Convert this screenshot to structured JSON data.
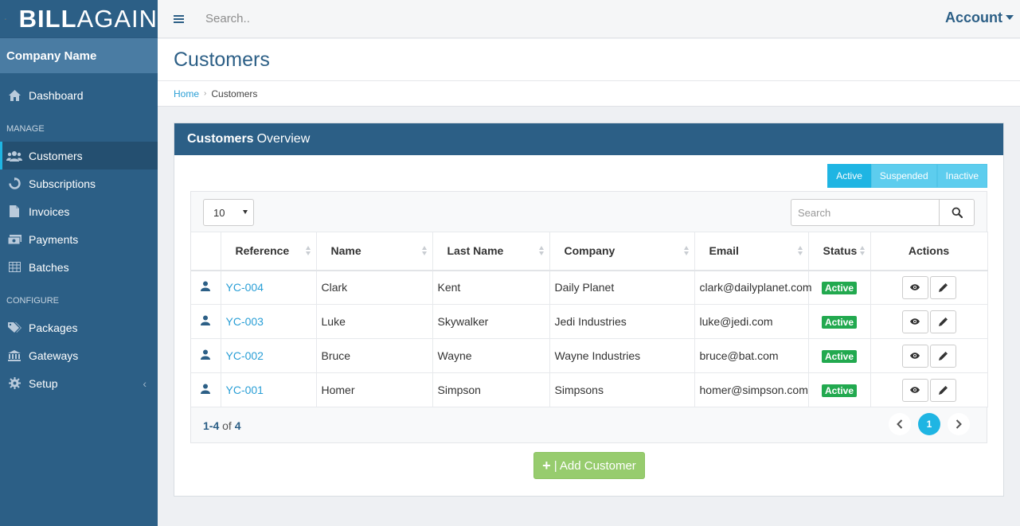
{
  "brand": {
    "logo_bold": "BILL",
    "logo_thin": "AGAIN",
    "colors": [
      "#e84c3d",
      "#f39c12",
      "#2ecc71",
      "#3498db",
      "#9b59b6"
    ]
  },
  "sidebar": {
    "company_name": "Company Name",
    "dashboard": {
      "label": "Dashboard",
      "icon": "home-icon"
    },
    "manage_title": "MANAGE",
    "manage_items": [
      {
        "label": "Customers",
        "icon": "users-icon",
        "active": true
      },
      {
        "label": "Subscriptions",
        "icon": "refresh-icon"
      },
      {
        "label": "Invoices",
        "icon": "file-icon"
      },
      {
        "label": "Payments",
        "icon": "money-icon"
      },
      {
        "label": "Batches",
        "icon": "table-icon"
      }
    ],
    "configure_title": "CONFIGURE",
    "configure_items": [
      {
        "label": "Packages",
        "icon": "tags-icon"
      },
      {
        "label": "Gateways",
        "icon": "bank-icon"
      },
      {
        "label": "Setup",
        "icon": "gear-icon"
      }
    ]
  },
  "topbar": {
    "search_placeholder": "Search..",
    "account_label": "Account"
  },
  "page": {
    "title": "Customers"
  },
  "breadcrumb": {
    "home": "Home",
    "current": "Customers"
  },
  "panel": {
    "title_bold": "Customers",
    "title_rest": "Overview",
    "filters": [
      "Active",
      "Suspended",
      "Inactive"
    ],
    "per_page": "10",
    "search_placeholder": "Search",
    "columns": [
      "Reference",
      "Name",
      "Last Name",
      "Company",
      "Email",
      "Status",
      "Actions"
    ],
    "rows": [
      {
        "ref": "YC-004",
        "name": "Clark",
        "last": "Kent",
        "company": "Daily Planet",
        "email": "clark@dailyplanet.com",
        "status": "Active"
      },
      {
        "ref": "YC-003",
        "name": "Luke",
        "last": "Skywalker",
        "company": "Jedi Industries",
        "email": "luke@jedi.com",
        "status": "Active"
      },
      {
        "ref": "YC-002",
        "name": "Bruce",
        "last": "Wayne",
        "company": "Wayne Industries",
        "email": "bruce@bat.com",
        "status": "Active"
      },
      {
        "ref": "YC-001",
        "name": "Homer",
        "last": "Simpson",
        "company": "Simpsons",
        "email": "homer@simpson.com",
        "status": "Active"
      }
    ],
    "range": "1-4",
    "of_label": "of",
    "total": "4",
    "current_page": "1",
    "add_label": "| Add Customer"
  }
}
